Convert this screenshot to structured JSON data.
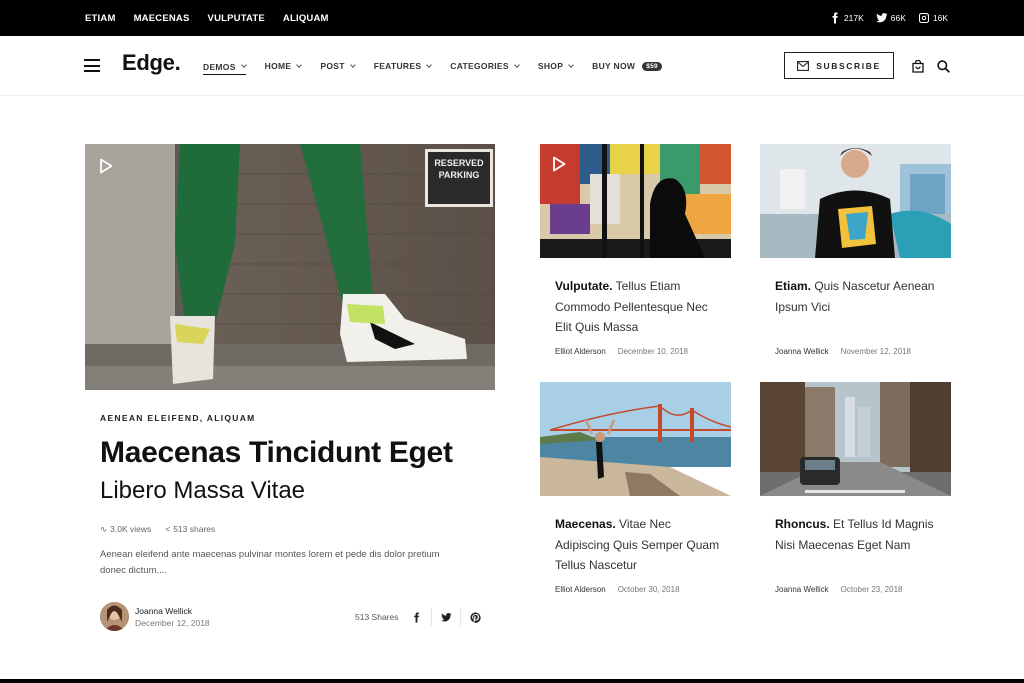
{
  "topbar": {
    "links": [
      "ETIAM",
      "MAECENAS",
      "VULPUTATE",
      "ALIQUAM"
    ],
    "social": [
      {
        "icon": "facebook-icon",
        "count": "217K"
      },
      {
        "icon": "twitter-icon",
        "count": "66K"
      },
      {
        "icon": "instagram-icon",
        "count": "16K"
      }
    ]
  },
  "header": {
    "logo": "Edge.",
    "nav": [
      {
        "label": "DEMOS",
        "dropdown": true
      },
      {
        "label": "HOME",
        "dropdown": true
      },
      {
        "label": "POST",
        "dropdown": true
      },
      {
        "label": "FEATURES",
        "dropdown": true
      },
      {
        "label": "CATEGORIES",
        "dropdown": true
      },
      {
        "label": "SHOP",
        "dropdown": true
      },
      {
        "label": "BUY NOW",
        "badge": "$59"
      }
    ],
    "subscribe_label": "SUBSCRIBE"
  },
  "featured": {
    "categories": "AENEAN ELEIFEND,  ALIQUAM",
    "title_line1": "Maecenas Tincidunt Eget",
    "title_line2": "Libero Massa Vitae",
    "views": "3.0K views",
    "shares": "513 shares",
    "excerpt": "Aenean eleifend ante maecenas pulvinar montes lorem et pede dis dolor pretium donec dictum....",
    "author": "Joanna Wellick",
    "date": "December 12, 2018",
    "share_count": "513 Shares",
    "image_sign": [
      "RESERVED",
      "PARKING"
    ]
  },
  "cards": [
    {
      "title_bold": "Vulputate.",
      "title_rest": " Tellus Etiam Commodo Pellentesque Nec Elit Quis Massa",
      "author": "Elliot Alderson",
      "date": "December 10, 2018"
    },
    {
      "title_bold": "Etiam.",
      "title_rest": " Quis Nascetur Aenean Ipsum Vici",
      "author": "Joanna Wellick",
      "date": "November 12, 2018"
    },
    {
      "title_bold": "Maecenas.",
      "title_rest": " Vitae Nec Adipiscing Quis Semper Quam Tellus Nascetur",
      "author": "Elliot Alderson",
      "date": "October 30, 2018"
    },
    {
      "title_bold": "Rhoncus.",
      "title_rest": " Et Tellus Id Magnis Nisi Maecenas Eget Nam",
      "author": "Joanna Wellick",
      "date": "October 23, 2018"
    }
  ]
}
